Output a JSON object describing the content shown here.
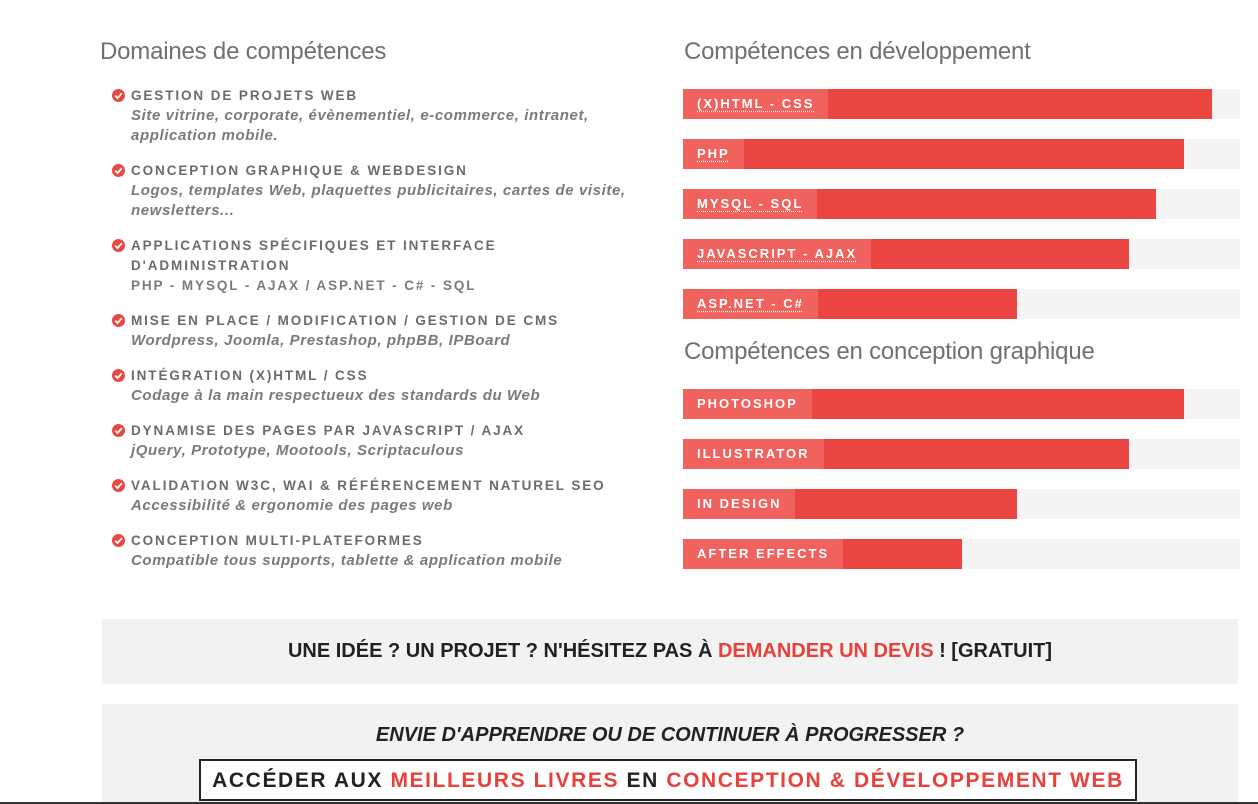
{
  "sections": {
    "domains_title": "Domaines de compétences",
    "dev_title": "Compétences en développement",
    "graph_title": "Compétences en conception graphique"
  },
  "domains": [
    {
      "title": "GESTION DE PROJETS WEB",
      "subtitle": "Site vitrine, corporate, évènementiel, e-commerce, intranet, application mobile."
    },
    {
      "title": "CONCEPTION GRAPHIQUE & WEBDESIGN",
      "subtitle": "Logos, templates Web, plaquettes publicitaires, cartes de visite, newsletters..."
    },
    {
      "title": "APPLICATIONS SPÉCIFIQUES ET INTERFACE D'ADMINISTRATION",
      "subtitle": "PHP - MYSQL - AJAX / ASP.NET - C# - SQL"
    },
    {
      "title": "MISE EN PLACE / MODIFICATION / GESTION DE CMS",
      "subtitle": "Wordpress, Joomla, Prestashop, phpBB, IPBoard"
    },
    {
      "title": "INTÉGRATION (X)HTML / CSS",
      "subtitle": "Codage à la main respectueux des standards du Web"
    },
    {
      "title": "DYNAMISE DES PAGES PAR JAVASCRIPT / AJAX",
      "subtitle": "jQuery, Prototype, Mootools, Scriptaculous"
    },
    {
      "title": "VALIDATION W3C, WAI & RÉFÉRENCEMENT NATUREL SEO",
      "subtitle": "Accessibilité & ergonomie des pages web"
    },
    {
      "title": "CONCEPTION MULTI-PLATEFORMES",
      "subtitle": "Compatible tous supports, tablette & application mobile"
    }
  ],
  "dev_skills": [
    {
      "label": "(X)HTML - CSS",
      "percent": 95
    },
    {
      "label": "PHP",
      "percent": 90
    },
    {
      "label": "MYSQL - SQL",
      "percent": 85
    },
    {
      "label": "JAVASCRIPT - AJAX",
      "percent": 80
    },
    {
      "label": "ASP.NET - C#",
      "percent": 60
    }
  ],
  "graph_skills": [
    {
      "label": "PHOTOSHOP",
      "percent": 90
    },
    {
      "label": "ILLUSTRATOR",
      "percent": 80
    },
    {
      "label": "IN DESIGN",
      "percent": 60
    },
    {
      "label": "AFTER EFFECTS",
      "percent": 50
    }
  ],
  "cta1": {
    "prefix": "UNE IDÉE ? UN PROJET ? N'HÉSITEZ PAS À ",
    "link": "DEMANDER UN DEVIS",
    "suffix": " ! [GRATUIT]"
  },
  "cta2": {
    "question": "ENVIE D'APPRENDRE OU DE CONTINUER À PROGRESSER ?",
    "button_prefix": "ACCÉDER AUX ",
    "button_link1": "MEILLEURS LIVRES",
    "button_mid": " EN ",
    "button_link2": "CONCEPTION & DÉVELOPPEMENT WEB"
  },
  "colors": {
    "accent": "#ea4540",
    "label_bg": "#f0625e",
    "track": "#f4f4f4"
  }
}
